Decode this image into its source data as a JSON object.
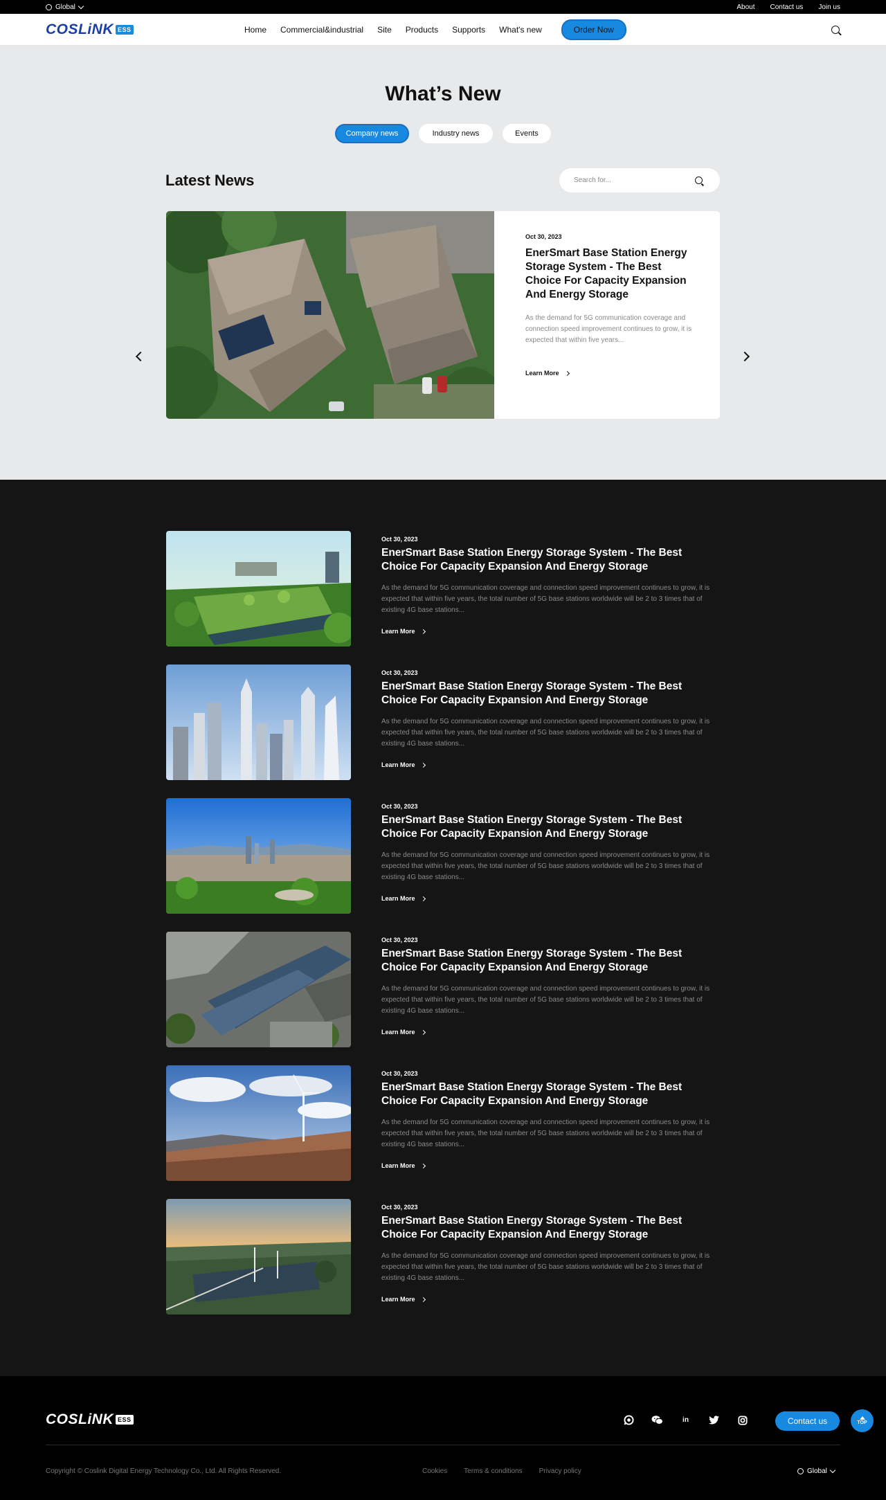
{
  "topbar": {
    "region": "Global",
    "links": [
      "About",
      "Contact us",
      "Join us"
    ]
  },
  "nav": {
    "logo_text": "COSLiNK",
    "logo_tag": "ESS",
    "items": [
      "Home",
      "Commercial&industrial",
      "Site",
      "Products",
      "Supports",
      "What's new"
    ],
    "order_button": "Order Now"
  },
  "page": {
    "title": "What’s New",
    "tabs": [
      "Company news",
      "Industry news",
      "Events"
    ],
    "active_tab": "Company news"
  },
  "latest": {
    "title": "Latest News",
    "search_placeholder": "Search for...",
    "featured": {
      "date": "Oct 30, 2023",
      "title": "EnerSmart Base Station Energy Storage System - The Best Choice For Capacity Expansion And Energy Storage",
      "desc": "As the demand for 5G communication coverage and connection speed improvement continues to grow, it is expected that within five years...",
      "cta": "Learn More"
    }
  },
  "articles": [
    {
      "date": "Oct 30, 2023",
      "title": "EnerSmart Base Station Energy Storage System - The Best Choice For Capacity Expansion And Energy Storage",
      "desc": "As the demand for 5G communication coverage and connection speed improvement continues to grow, it is expected that within five years, the total number of 5G base stations worldwide will be 2 to 3 times that of existing 4G base stations...",
      "cta": "Learn More",
      "image": "green-building"
    },
    {
      "date": "Oct 30, 2023",
      "title": "EnerSmart Base Station Energy Storage System - The Best Choice For Capacity Expansion And Energy Storage",
      "desc": "As the demand for 5G communication coverage and connection speed improvement continues to grow, it is expected that within five years, the total number of 5G base stations worldwide will be 2 to 3 times that of existing 4G base stations...",
      "cta": "Learn More",
      "image": "skyscrapers"
    },
    {
      "date": "Oct 30, 2023",
      "title": "EnerSmart Base Station Energy Storage System - The Best Choice For Capacity Expansion And Energy Storage",
      "desc": "As the demand for 5G communication coverage and connection speed improvement continues to grow, it is expected that within five years, the total number of 5G base stations worldwide will be 2 to 3 times that of existing 4G base stations...",
      "cta": "Learn More",
      "image": "city-skyline"
    },
    {
      "date": "Oct 30, 2023",
      "title": "EnerSmart Base Station Energy Storage System - The Best Choice For Capacity Expansion And Energy Storage",
      "desc": "As the demand for 5G communication coverage and connection speed improvement continues to grow, it is expected that within five years, the total number of 5G base stations worldwide will be 2 to 3 times that of existing 4G base stations...",
      "cta": "Learn More",
      "image": "solar-carport"
    },
    {
      "date": "Oct 30, 2023",
      "title": "EnerSmart Base Station Energy Storage System - The Best Choice For Capacity Expansion And Energy Storage",
      "desc": "As the demand for 5G communication coverage and connection speed improvement continues to grow, it is expected that within five years, the total number of 5G base stations worldwide will be 2 to 3 times that of existing 4G base stations...",
      "cta": "Learn More",
      "image": "wind-turbine"
    },
    {
      "date": "Oct 30, 2023",
      "title": "EnerSmart Base Station Energy Storage System - The Best Choice For Capacity Expansion And Energy Storage",
      "desc": "As the demand for 5G communication coverage and connection speed improvement continues to grow, it is expected that within five years, the total number of 5G base stations worldwide will be 2 to 3 times that of existing 4G base stations...",
      "cta": "Learn More",
      "image": "solar-field-sunset"
    }
  ],
  "footer": {
    "logo_text": "COSLiNK",
    "logo_tag": "ESS",
    "socials": [
      "whatsapp-icon",
      "wechat-icon",
      "linkedin-icon",
      "twitter-icon",
      "instagram-icon"
    ],
    "contact_button": "Contact us",
    "top_button": "TOP",
    "copyright": "Copyright © Coslink Digital Energy Technology Co., Ltd. All Rights Reserved.",
    "links": [
      "Cookies",
      "Terms & conditions",
      "Privacy policy"
    ],
    "region": "Global"
  },
  "colors": {
    "accent": "#1889e0",
    "brand_navy": "#1b3fa6",
    "dark_bg": "#151515",
    "light_bg": "#e8e9eb"
  }
}
